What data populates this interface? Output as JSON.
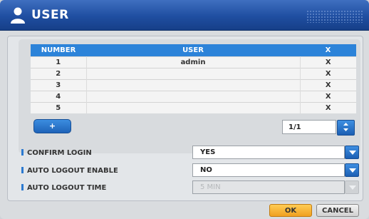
{
  "window": {
    "title": "USER"
  },
  "table": {
    "headers": {
      "number": "NUMBER",
      "user": "USER",
      "delete": "X"
    },
    "rows": [
      {
        "number": "1",
        "user": "admin",
        "delete": "X"
      },
      {
        "number": "2",
        "user": "",
        "delete": "X"
      },
      {
        "number": "3",
        "user": "",
        "delete": "X"
      },
      {
        "number": "4",
        "user": "",
        "delete": "X"
      },
      {
        "number": "5",
        "user": "",
        "delete": "X"
      }
    ]
  },
  "add_button": {
    "label": "+"
  },
  "pager": {
    "value": "1/1"
  },
  "settings": {
    "confirm_login": {
      "label": "CONFIRM LOGIN",
      "value": "YES"
    },
    "auto_logout_enable": {
      "label": "AUTO LOGOUT ENABLE",
      "value": "NO"
    },
    "auto_logout_time": {
      "label": "AUTO LOGOUT TIME",
      "value": "5 MIN"
    }
  },
  "buttons": {
    "ok": "OK",
    "cancel": "CANCEL"
  },
  "colors": {
    "accent": "#2c83d9",
    "title_bar": "#1f4ea1",
    "ok_button": "#f0a020"
  },
  "icons": {
    "title": "user-icon",
    "spin": "up-down-arrows-icon",
    "dropdown": "chevron-down-icon"
  }
}
